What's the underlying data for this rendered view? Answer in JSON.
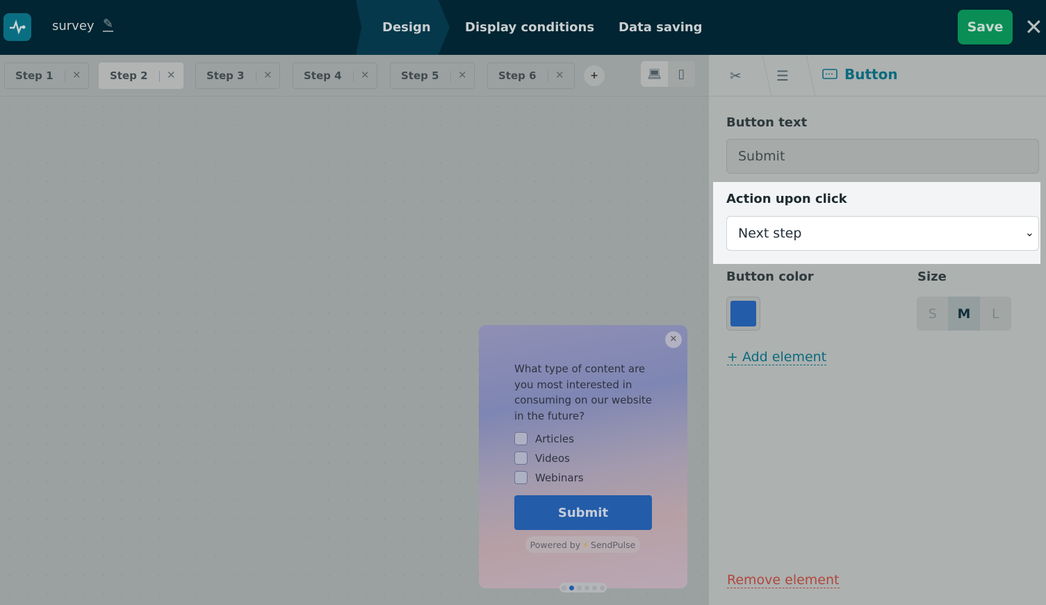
{
  "header": {
    "title": "survey",
    "tabs": [
      "Design",
      "Display conditions",
      "Data saving"
    ],
    "save_label": "Save"
  },
  "steps": [
    "Step 1",
    "Step 2",
    "Step 3",
    "Step 4",
    "Step 5",
    "Step 6"
  ],
  "popup": {
    "question": "What type of content are you most interested in consuming on our website in the future?",
    "options": [
      "Articles",
      "Videos",
      "Webinars"
    ],
    "submit": "Submit",
    "powered_by": "Powered by",
    "brand": "SendPulse",
    "pages": 6,
    "current_page": 2
  },
  "panel": {
    "breadcrumb_current": "Button",
    "button_text_label": "Button text",
    "button_text_value": "Submit",
    "action_label": "Action upon click",
    "action_value": "Next step",
    "color_label": "Button color",
    "color_value": "#235ca9",
    "size_label": "Size",
    "sizes": [
      "S",
      "M",
      "L"
    ],
    "size_selected": "M",
    "add_element": "+ Add element",
    "remove_element": "Remove element"
  }
}
